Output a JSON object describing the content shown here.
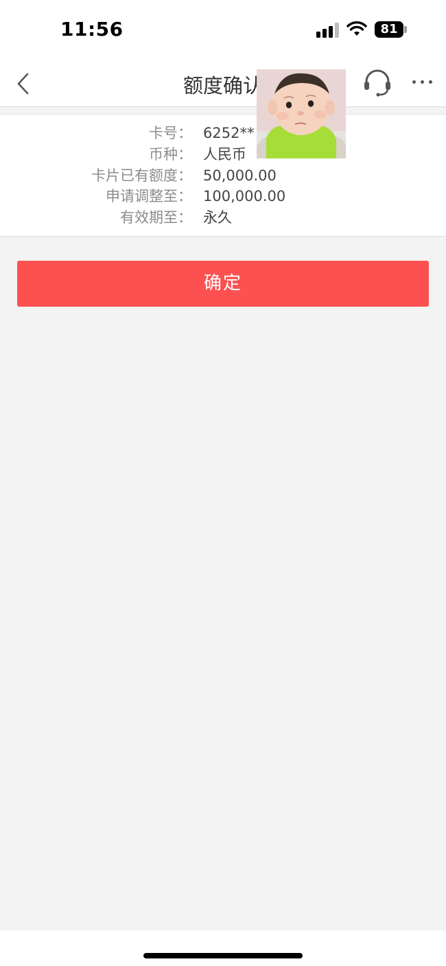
{
  "status_bar": {
    "time": "11:56",
    "battery": "81",
    "icons": [
      "signal-icon",
      "wifi-icon",
      "battery-icon"
    ]
  },
  "nav": {
    "title": "额度确认",
    "icons": [
      "back-icon",
      "headset-icon",
      "more-icon"
    ]
  },
  "info": {
    "rows": [
      {
        "label": "卡号：",
        "value": "6252**"
      },
      {
        "label": "币种：",
        "value": "人民币"
      },
      {
        "label": "卡片已有额度：",
        "value": "50,000.00"
      },
      {
        "label": "申请调整至：",
        "value": "100,000.00"
      },
      {
        "label": "有效期至：",
        "value": "永久"
      }
    ]
  },
  "confirm_label": "确定",
  "colors": {
    "accent": "#fd5151",
    "background": "#f3f3f3",
    "card": "#ffffff",
    "label": "#8c8c8c",
    "value": "#444444"
  }
}
